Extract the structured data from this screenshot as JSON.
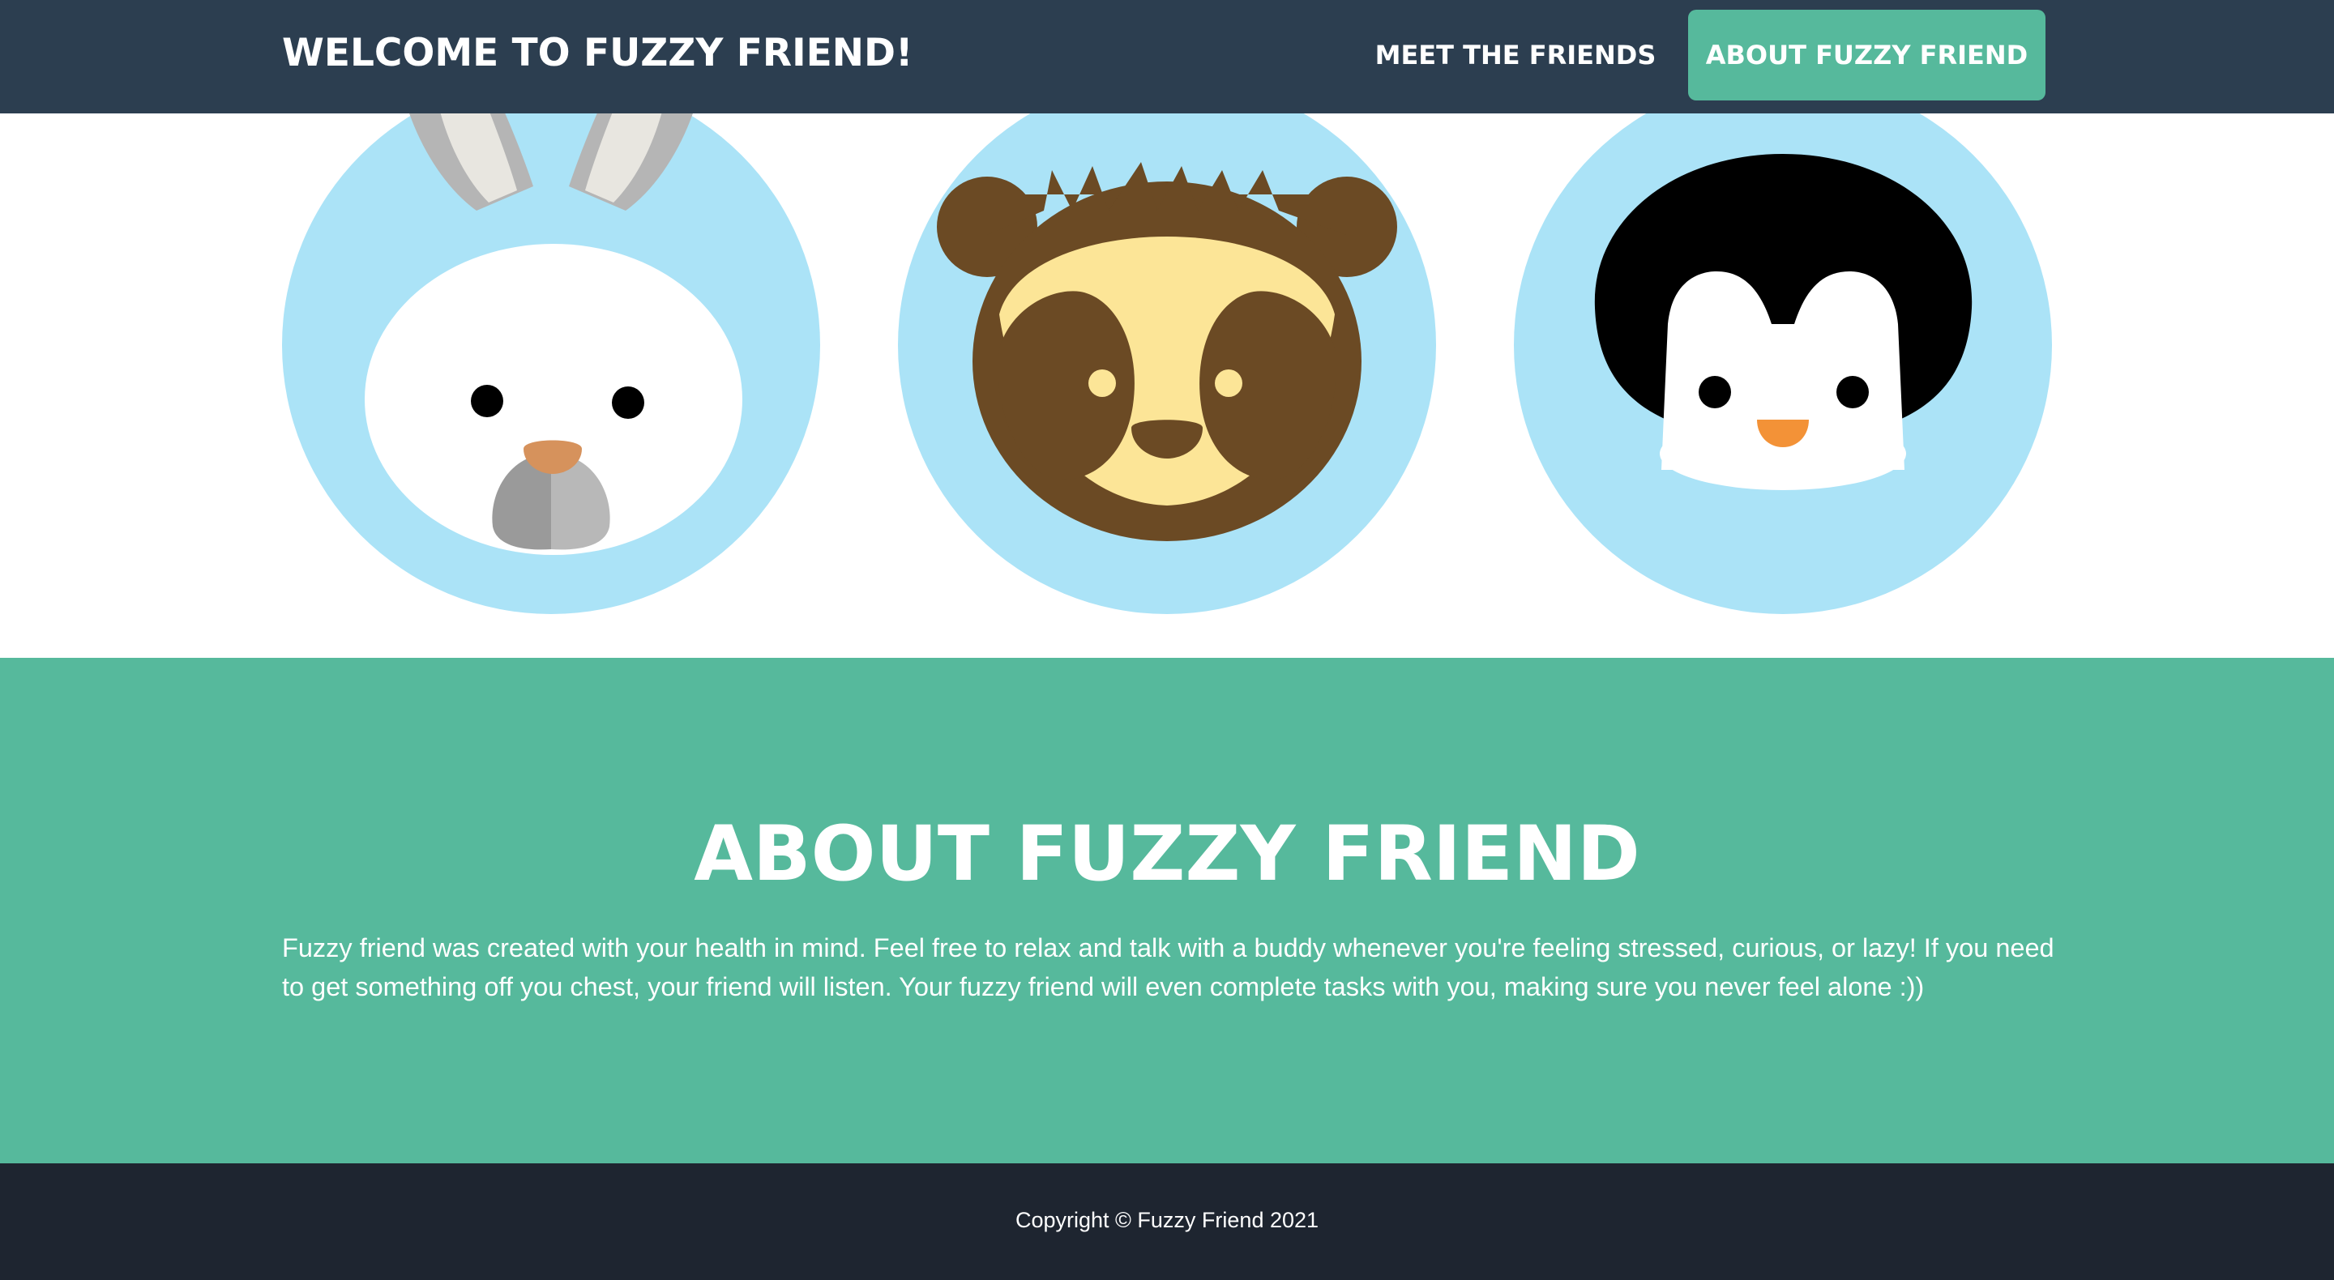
{
  "navbar": {
    "brand": "WELCOME TO FUZZY FRIEND!",
    "links": [
      {
        "label": "MEET THE FRIENDS"
      },
      {
        "label": "ABOUT FUZZY FRIEND",
        "active": true
      }
    ]
  },
  "friends": [
    {
      "animal": "bunny",
      "icon": "bunny-avatar-icon"
    },
    {
      "animal": "sloth",
      "icon": "sloth-avatar-icon"
    },
    {
      "animal": "penguin",
      "icon": "penguin-avatar-icon"
    }
  ],
  "about": {
    "title": "ABOUT FUZZY FRIEND",
    "text": "Fuzzy friend was created with your health in mind. Feel free to relax and talk with a buddy whenever you're feeling stressed, curious, or lazy! If you need to get something off you chest, your friend will listen. Your fuzzy friend will even complete tasks with you, making sure you never feel alone :))"
  },
  "footer": {
    "copyright": "Copyright © Fuzzy Friend 2021"
  },
  "colors": {
    "navbar": "#2c3e50",
    "accent": "#56b99c",
    "footer": "#1e2530",
    "avatar_bg": "#abe3f7"
  }
}
